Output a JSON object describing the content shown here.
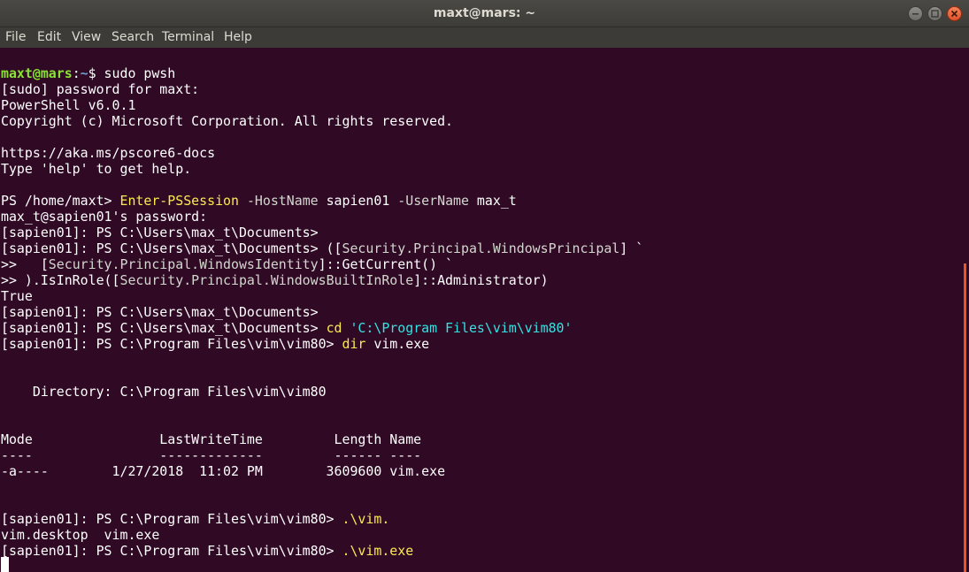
{
  "window": {
    "title": "maxt@mars: ~"
  },
  "menu": {
    "file": "File",
    "edit": "Edit",
    "view": "View",
    "search": "Search",
    "terminal": "Terminal",
    "help": "Help"
  },
  "colors": {
    "background": "#300a24",
    "prompt_user": "#8ae234",
    "prompt_path": "#729fcf",
    "command": "#fce94f",
    "parameter": "#d3d7cf",
    "string": "#34e2e2",
    "scroll_accent": "#e95420"
  },
  "terminal": {
    "l1_user": "maxt@mars",
    "l1_colon": ":",
    "l1_path": "~",
    "l1_rest": "$ sudo pwsh",
    "l2": "[sudo] password for maxt:",
    "l3": "PowerShell v6.0.1",
    "l4": "Copyright (c) Microsoft Corporation. All rights reserved.",
    "l6": "https://aka.ms/pscore6-docs",
    "l7": "Type 'help' to get help.",
    "l9_prompt": "PS /home/maxt> ",
    "l9_cmd": "Enter-PSSession",
    "l9_sp1": " ",
    "l9_param1": "-HostName",
    "l9_val1": " sapien01 ",
    "l9_param2": "-UserName",
    "l9_val2": " max_t",
    "l10": "max_t@sapien01's password:",
    "l11": "[sapien01]: PS C:\\Users\\max_t\\Documents>",
    "l12_prompt": "[sapien01]: PS C:\\Users\\max_t\\Documents> ([",
    "l12_type": "Security.Principal.WindowsPrincipal",
    "l12_rest": "] `",
    "l13_prompt": ">>   [",
    "l13_type": "Security.Principal.WindowsIdentity",
    "l13_rest": "]::GetCurrent() `",
    "l14_prompt": ">> ).IsInRole([",
    "l14_type": "Security.Principal.WindowsBuiltInRole",
    "l14_rest": "]::Administrator)",
    "l15": "True",
    "l16": "[sapien01]: PS C:\\Users\\max_t\\Documents>",
    "l17_prompt": "[sapien01]: PS C:\\Users\\max_t\\Documents> ",
    "l17_cmd": "cd",
    "l17_sp": " ",
    "l17_str": "'C:\\Program Files\\vim\\vim80'",
    "l18_prompt": "[sapien01]: PS C:\\Program Files\\vim\\vim80> ",
    "l18_cmd": "dir",
    "l18_arg": " vim.exe",
    "l21": "    Directory: C:\\Program Files\\vim\\vim80",
    "l24": "Mode                LastWriteTime         Length Name",
    "l25": "----                -------------         ------ ----",
    "l26": "-a----        1/27/2018  11:02 PM        3609600 vim.exe",
    "l29_prompt": "[sapien01]: PS C:\\Program Files\\vim\\vim80> ",
    "l29_cmd": ".\\vim.",
    "l30": "vim.desktop  vim.exe",
    "l31_prompt": "[sapien01]: PS C:\\Program Files\\vim\\vim80> ",
    "l31_cmd": ".\\vim.exe"
  }
}
